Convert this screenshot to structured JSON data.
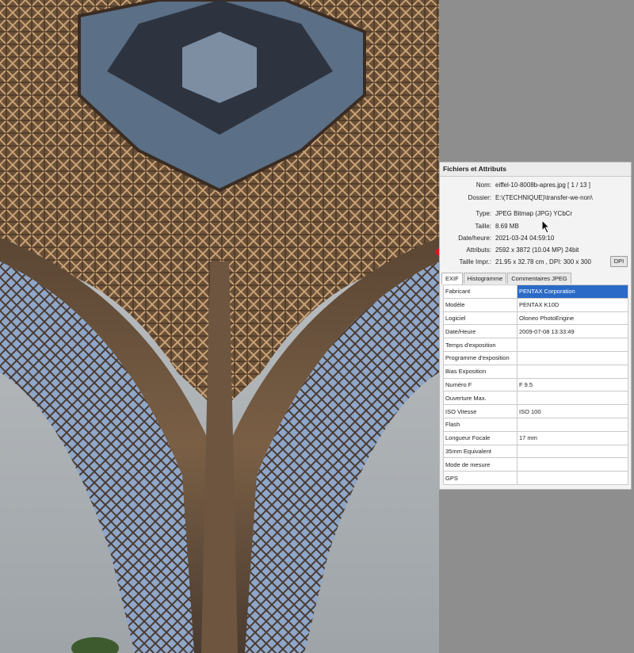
{
  "panel": {
    "title": "Fichiers et Attributs",
    "attributes": [
      {
        "label": "Nom:",
        "value": "eiffel-10-8008b-apres.jpg   [ 1 / 13 ]"
      },
      {
        "label": "Dossier:",
        "value": "E:\\(TECHNIQUE)\\transfer-we-non\\"
      },
      {
        "label": "Type:",
        "value": "JPEG Bitmap (JPG) YCbCr"
      },
      {
        "label": "Taille:",
        "value": "8.69 MB"
      },
      {
        "label": "Date/heure:",
        "value": "2021-03-24 04:59:10"
      },
      {
        "label": "Attributs:",
        "value": "2592 x 3872 (10.04 MP)  24bit"
      },
      {
        "label": "Taille Impr.:",
        "value": "21.95 x 32.78 cm ,  DPI: 300 x 300"
      }
    ],
    "dpi_button": "DPI",
    "tabs": [
      "EXIF",
      "Histogramme",
      "Commentaires JPEG"
    ],
    "exif": [
      {
        "key": "Fabricant",
        "value": "PENTAX Corporation"
      },
      {
        "key": "Modèle",
        "value": "PENTAX K10D"
      },
      {
        "key": "Logiciel",
        "value": "Oloneo PhotoEngine"
      },
      {
        "key": "Date/Heure",
        "value": "2009-07-08 13:33:49"
      },
      {
        "key": "Temps d'exposition",
        "value": ""
      },
      {
        "key": "Programme d'exposition",
        "value": ""
      },
      {
        "key": "Bias Exposition",
        "value": ""
      },
      {
        "key": "Numéro F",
        "value": "F 9.5"
      },
      {
        "key": "Ouverture Max.",
        "value": ""
      },
      {
        "key": "ISO Vitesse",
        "value": "ISO 100"
      },
      {
        "key": "Flash",
        "value": ""
      },
      {
        "key": "Longueur Focale",
        "value": "17 mm"
      },
      {
        "key": "35mm Equivalent",
        "value": ""
      },
      {
        "key": "Mode de mesure",
        "value": ""
      },
      {
        "key": "GPS",
        "value": ""
      }
    ]
  },
  "colors": {
    "selection": "#2b6bc7",
    "arrow": "#e0141c"
  }
}
